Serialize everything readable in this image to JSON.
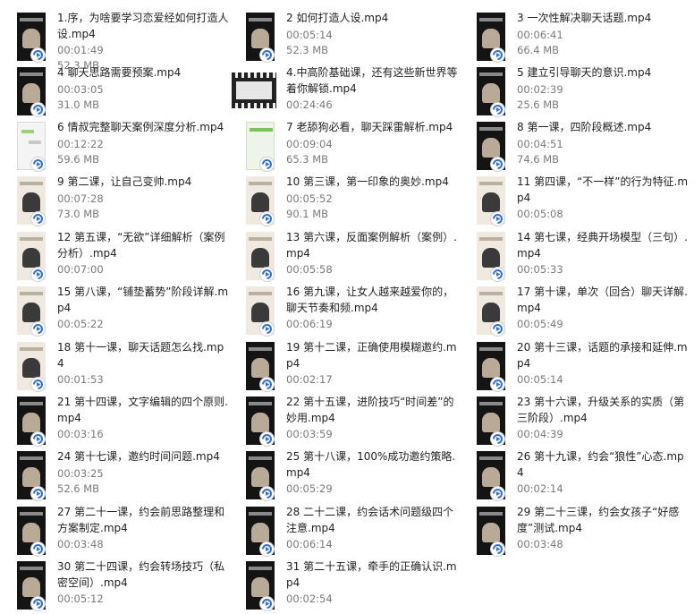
{
  "files": [
    {
      "name": "1.序，为啥要学习恋爱经如何打造人设.mp4",
      "duration": "00:01:49",
      "size": "52.3 MB"
    },
    {
      "name": "2 如何打造人设.mp4",
      "duration": "00:05:14",
      "size": "52.3 MB"
    },
    {
      "name": "3 一次性解决聊天话题.mp4",
      "duration": "00:06:41",
      "size": "66.4 MB"
    },
    {
      "name": "4 聊天思路需要预案.mp4",
      "duration": "00:03:05",
      "size": "31.0 MB"
    },
    {
      "name": "4.中高阶基础课，还有这些新世界等着你解锁.mp4",
      "duration": "00:24:46",
      "size": ""
    },
    {
      "name": "5 建立引导聊天的意识.mp4",
      "duration": "00:02:39",
      "size": "25.6 MB"
    },
    {
      "name": "6 情叔完整聊天案例深度分析.mp4",
      "duration": "00:12:22",
      "size": "59.6 MB"
    },
    {
      "name": "7 老舔狗必看，聊天踩雷解析.mp4",
      "duration": "00:09:04",
      "size": "65.3 MB"
    },
    {
      "name": "8 第一课，四阶段概述.mp4",
      "duration": "00:04:51",
      "size": "74.6 MB"
    },
    {
      "name": "9 第二课，让自己变帅.mp4",
      "duration": "00:07:28",
      "size": "73.0 MB"
    },
    {
      "name": "10 第三课，第一印象的奥妙.mp4",
      "duration": "00:05:52",
      "size": "90.1 MB"
    },
    {
      "name": "11 第四课，“不一样”的行为特征.mp4",
      "duration": "00:05:08",
      "size": ""
    },
    {
      "name": "12 第五课，“无欲”详细解析（案例分析）.mp4",
      "duration": "00:07:00",
      "size": ""
    },
    {
      "name": "13 第六课，反面案例解析（案例）.mp4",
      "duration": "00:05:58",
      "size": ""
    },
    {
      "name": "14 第七课，经典开场模型（三句）.mp4",
      "duration": "00:05:33",
      "size": ""
    },
    {
      "name": "15 第八课，“铺垫蓄势”阶段详解.mp4",
      "duration": "00:05:22",
      "size": ""
    },
    {
      "name": "16 第九课，让女人越来越爱你的，聊天节奏和频.mp4",
      "duration": "00:06:19",
      "size": ""
    },
    {
      "name": "17 第十课，单次（回合）聊天详解.mp4",
      "duration": "00:05:49",
      "size": ""
    },
    {
      "name": "18 第十一课，聊天话题怎么找.mp4",
      "duration": "00:01:53",
      "size": ""
    },
    {
      "name": "19 第十二课，正确使用模糊邀约.mp4",
      "duration": "00:02:17",
      "size": ""
    },
    {
      "name": "20 第十三课，话题的承接和延伸.mp4",
      "duration": "00:05:14",
      "size": ""
    },
    {
      "name": "21 第十四课，文字编辑的四个原则.mp4",
      "duration": "00:03:16",
      "size": ""
    },
    {
      "name": "22 第十五课，进阶技巧“时间差”的妙用.mp4",
      "duration": "00:03:59",
      "size": ""
    },
    {
      "name": "23 第十六课，升级关系的实质（第三阶段）.mp4",
      "duration": "00:04:39",
      "size": ""
    },
    {
      "name": "24 第十七课，邀约时间问题.mp4",
      "duration": "00:03:25",
      "size": "52.6 MB"
    },
    {
      "name": "25 第十八课，100%成功邀约策略.mp4",
      "duration": "00:05:29",
      "size": ""
    },
    {
      "name": "26 第十九课，约会“狼性”心态.mp4",
      "duration": "00:02:14",
      "size": ""
    },
    {
      "name": "27 第二十一课，约会前思路整理和方案制定.mp4",
      "duration": "00:03:48",
      "size": ""
    },
    {
      "name": "28 二十二课，约会话术问题级四个注意.mp4",
      "duration": "00:06:14",
      "size": ""
    },
    {
      "name": "29 第二十三课，约会女孩子“好感度”测试.mp4",
      "duration": "00:03:48",
      "size": ""
    },
    {
      "name": "30 第二十四课，约会转场技巧（私密空间）.mp4",
      "duration": "00:05:12",
      "size": ""
    },
    {
      "name": "31 第二十五课，牵手的正确认识.mp4",
      "duration": "00:02:54",
      "size": ""
    }
  ],
  "thumb_styles": [
    "dark",
    "dark",
    "dark",
    "dark",
    "wide",
    "dark",
    "chat",
    "chatgreen",
    "dark",
    "light",
    "light",
    "light",
    "light",
    "light",
    "light",
    "light",
    "light",
    "light",
    "light",
    "dark",
    "dark",
    "dark",
    "dark",
    "dark",
    "dark",
    "dark",
    "dark",
    "dark",
    "dark",
    "dark",
    "dark",
    "dark"
  ],
  "icons": {
    "thumbnail": "video-thumbnail-icon",
    "badge": "media-player-badge-icon"
  },
  "colors": {
    "name_text": "#1f1f1f",
    "meta_text": "#7a7a7a",
    "badge_blue": "#2f6fd6",
    "background": "#ffffff"
  }
}
